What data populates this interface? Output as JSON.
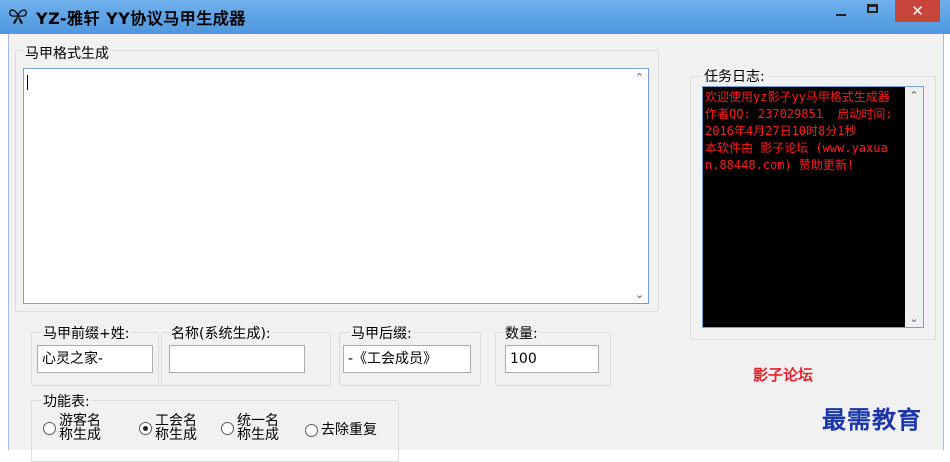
{
  "window": {
    "title": "YZ-雅轩  YY协议马甲生成器",
    "minimize_symbol": "—",
    "close_symbol": "✕",
    "icon": "butterfly-icon"
  },
  "main": {
    "group_label": "马甲格式生成",
    "text_value": ""
  },
  "log": {
    "group_label": "任务日志:",
    "text": "欢迎使用yz影子yy马甲格式生成器 作者QQ: 237029851  启动时间: 2016年4月27日10时8分1秒\n本软件由 影子论坛 (www.yaxuan.88448.com) 赞助更新!"
  },
  "fields": {
    "prefix": {
      "label": "马甲前缀+姓:",
      "value": "心灵之家-"
    },
    "name": {
      "label": "名称(系统生成):",
      "value": ""
    },
    "suffix": {
      "label": "马甲后缀:",
      "value": "-《工会成员》"
    },
    "count": {
      "label": "数量:",
      "value": "100"
    }
  },
  "functions": {
    "label": "功能表:",
    "options": [
      {
        "label": "游客名称生成",
        "checked": false
      },
      {
        "label": "工会名称生成",
        "checked": true
      },
      {
        "label": "统一名称生成",
        "checked": false
      },
      {
        "label": "去除重复",
        "checked": false
      }
    ]
  },
  "forum_link": "影子论坛",
  "watermark": "最需教育",
  "colors": {
    "titlebar": "#5aa2e6",
    "close_button": "#c7453a",
    "log_background": "#000000",
    "log_text": "#ff1a1a",
    "link": "#e8202a",
    "watermark": "#1a36a8"
  }
}
